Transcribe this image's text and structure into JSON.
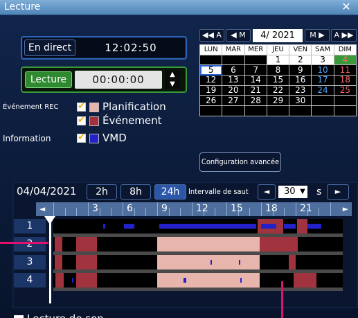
{
  "window": {
    "title": "Lecture",
    "close": "✕"
  },
  "live": {
    "button": "En direct",
    "time": "12:02:50"
  },
  "playback": {
    "button": "Lecture",
    "time": "00:00:00",
    "up": "▲",
    "down": "▼"
  },
  "rec_event": {
    "label": "Événement REC",
    "schedule": "Planification",
    "event": "Événement",
    "schedule_color": "#e8b5ad",
    "event_color": "#a0333d"
  },
  "information": {
    "label": "Information",
    "vmd": "VMD",
    "vmd_color": "#2222c8"
  },
  "calendar": {
    "nav": {
      "prev_year": "◀◀ A",
      "prev_month": "◀ M",
      "month": "4/ 2021",
      "next_month": "M ▶",
      "next_year": "A ▶▶"
    },
    "headers": [
      "LUN",
      "MAR",
      "MER",
      "JEU",
      "VEN",
      "SAM",
      "DIM"
    ],
    "weeks": [
      [
        "",
        "",
        "",
        "1",
        "2",
        "3",
        "4"
      ],
      [
        "5",
        "6",
        "7",
        "8",
        "9",
        "10",
        "11"
      ],
      [
        "12",
        "13",
        "14",
        "15",
        "16",
        "17",
        "18"
      ],
      [
        "19",
        "20",
        "21",
        "22",
        "23",
        "24",
        "25"
      ],
      [
        "26",
        "27",
        "28",
        "29",
        "30",
        "",
        ""
      ],
      [
        "",
        "",
        "",
        "",
        "",
        "",
        ""
      ]
    ],
    "today": "5",
    "selected": "4"
  },
  "advanced_button": "Configuration avancée",
  "timeline": {
    "date": "04/04/2021",
    "ranges": [
      "2h",
      "8h",
      "24h"
    ],
    "selected_range": "24h",
    "skip_label": "Intervalle de saut",
    "skip_prev": "◄",
    "skip_value": "30",
    "skip_dropdown": "▼",
    "skip_unit": "s",
    "skip_next": "►",
    "hour_labels": [
      "3",
      "6",
      "9",
      "12",
      "15",
      "18",
      "21"
    ],
    "ruler_left": "◄",
    "ruler_right": "►",
    "cameras": [
      "1",
      "2",
      "3",
      "4"
    ],
    "current_hour": 0
  },
  "sound": {
    "label": "Lecture de son",
    "checked": false
  }
}
